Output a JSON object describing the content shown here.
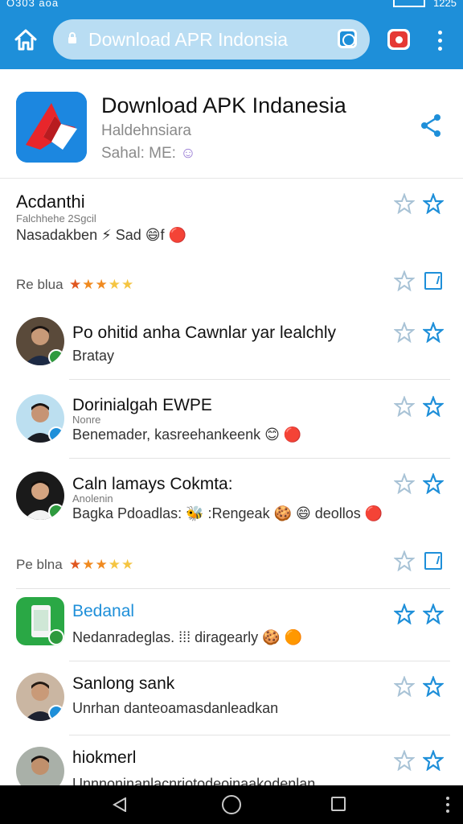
{
  "status_bar": {
    "left_text": "O303 aoa",
    "time": "1225"
  },
  "browser": {
    "url": "Download APR Indonsia"
  },
  "app": {
    "title": "Download APK Indanesia",
    "subtitle": "Haldehnsiara",
    "meta": "Sahal: ME:"
  },
  "rows": [
    {
      "name": "Acdanthi",
      "handle": "Falchhehe 2Sgcil",
      "message": "Nasadakben ⚡ Sad 😄f 🔴",
      "stars": "grey-blue"
    },
    {
      "section": "Re blua",
      "rating": "★★★★★"
    },
    {
      "name": "Po ohitid anha Cawnlar yar lealchly",
      "message": "Bratay",
      "badge_color": "#2e9a3e"
    },
    {
      "name": "Dorinialgah EWPE",
      "handle": "Nonre",
      "message": "Benemader, kasreehankeenk 😊 🔴",
      "badge_color": "#1e8fd9"
    },
    {
      "name": "Caln lamays Cokmta:",
      "handle": "Anolenin",
      "message": "Bagka Pdoadlas: 🐝 :Rengeak 🍪 😄 deollos 🔴",
      "badge_color": "#2e9a3e"
    },
    {
      "section": "Pe blna",
      "rating": "★★★★★"
    },
    {
      "name": "Bedanal",
      "message": "Nedanradeglas. ⁞⁞⁞ diragearly 🍪 🟠",
      "badge_color": "#2e9a3e"
    },
    {
      "name": "Sanlong sank",
      "message": "Unrhan danteoamasdanleadkan",
      "badge_color": "#1e8fd9"
    },
    {
      "name": "hiokmerl",
      "message": "Unnnoninanlacnriotodeoinaakodenlan",
      "badge_color": "#2e9a3e"
    }
  ],
  "colors": {
    "accent": "#1e8fd9",
    "header": "#1e8fd9",
    "verified_green": "#2e9a3e"
  },
  "icons": [
    "home-icon",
    "lock-icon",
    "tab-icon",
    "youtube-icon",
    "menu-icon",
    "share-icon",
    "star-icon",
    "edit-icon",
    "back-icon",
    "nav-home-icon",
    "recent-icon"
  ]
}
